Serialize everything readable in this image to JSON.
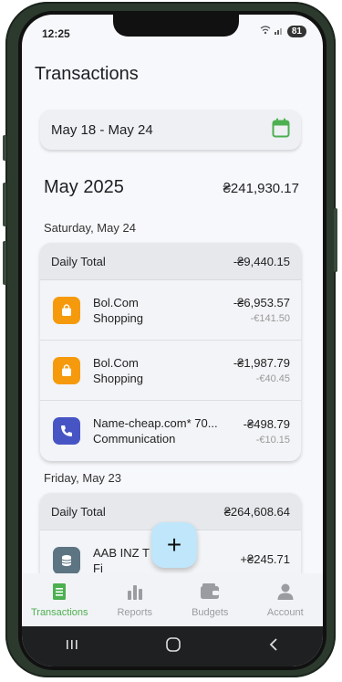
{
  "status_bar": {
    "time": "12:25",
    "battery": "81"
  },
  "header": {
    "title": "Transactions"
  },
  "date_range": {
    "label": "May 18 - May 24",
    "icon": "calendar-icon"
  },
  "month": {
    "title": "May 2025",
    "total": "₴241,930.17"
  },
  "days": [
    {
      "label": "Saturday, May 24",
      "daily_total_label": "Daily Total",
      "daily_total": "-₴9,440.15",
      "transactions": [
        {
          "name": "Bol.Com",
          "category": "Shopping",
          "amount": "-₴6,953.57",
          "original": "-€141.50",
          "icon": "shopping-bag-icon",
          "color": "#f59a0c"
        },
        {
          "name": "Bol.Com",
          "category": "Shopping",
          "amount": "-₴1,987.79",
          "original": "-€40.45",
          "icon": "shopping-bag-icon",
          "color": "#f59a0c"
        },
        {
          "name": "Name-cheap.com* 70...",
          "category": "Communication",
          "amount": "-₴498.79",
          "original": "-€10.15",
          "icon": "phone-icon",
          "color": "#4755c4"
        }
      ]
    },
    {
      "label": "Friday, May 23",
      "daily_total_label": "Daily Total",
      "daily_total": "₴264,608.64",
      "transactions": [
        {
          "name": "AAB INZ T",
          "category": "Fi",
          "amount": "+₴245.71",
          "original": "",
          "icon": "coins-icon",
          "color": "#5d7482"
        }
      ]
    }
  ],
  "fab": {
    "label": "+"
  },
  "nav": [
    {
      "label": "Transactions",
      "icon": "receipt-icon",
      "active": true
    },
    {
      "label": "Reports",
      "icon": "bar-chart-icon",
      "active": false
    },
    {
      "label": "Budgets",
      "icon": "wallet-icon",
      "active": false
    },
    {
      "label": "Account",
      "icon": "person-icon",
      "active": false
    }
  ],
  "colors": {
    "accent": "#4caf50",
    "fab": "#bfe6fa"
  }
}
